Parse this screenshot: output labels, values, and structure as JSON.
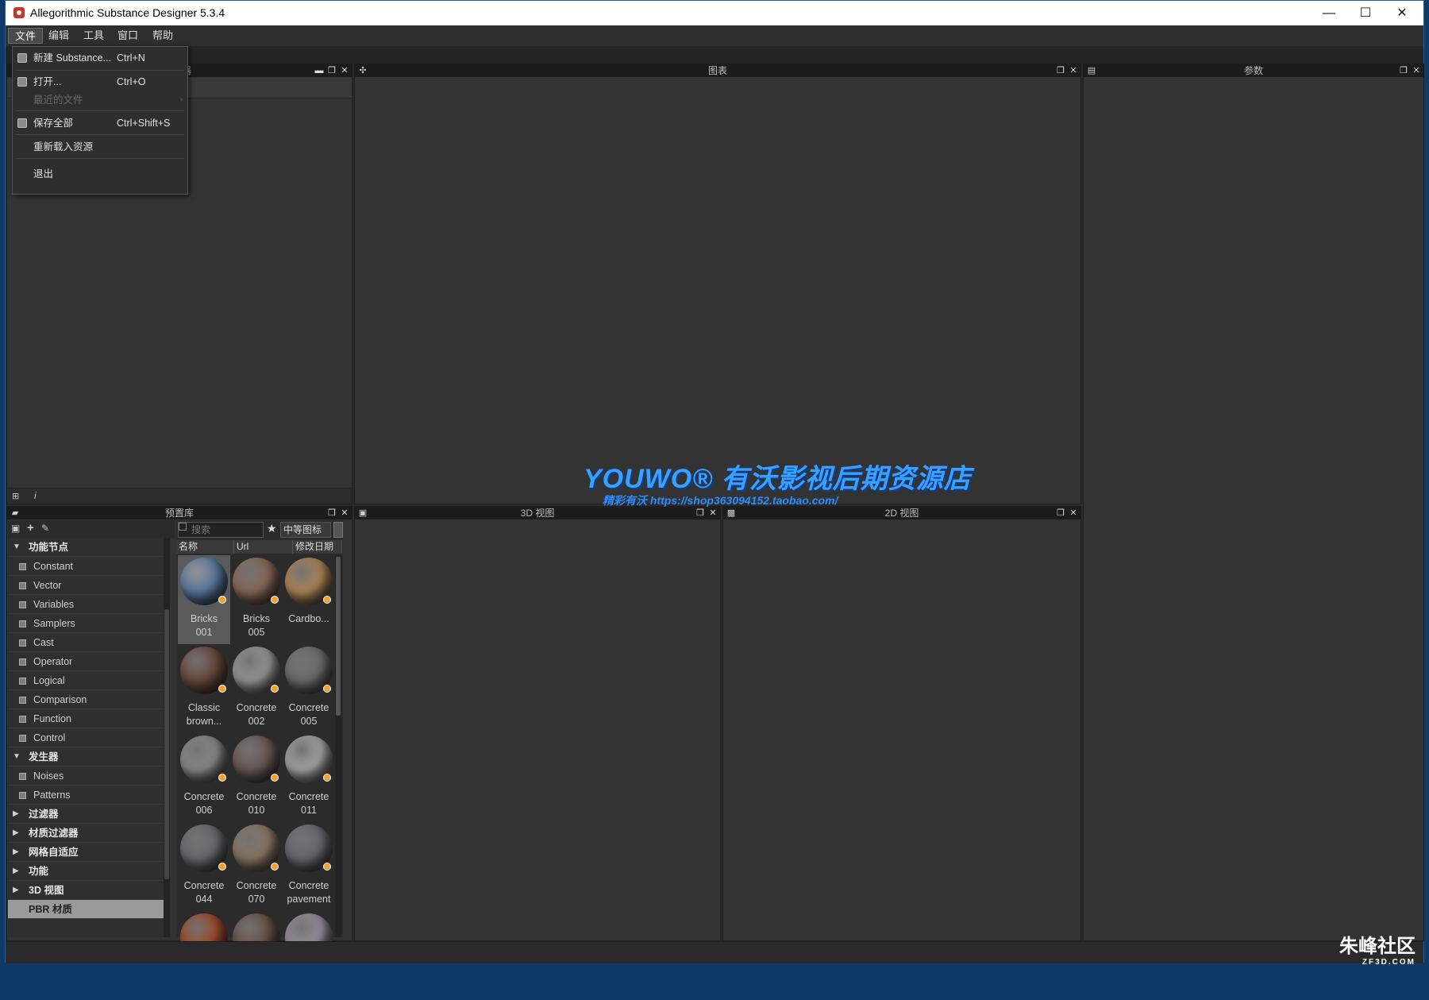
{
  "window": {
    "title": "Allegorithmic Substance Designer 5.3.4",
    "controls": [
      "—",
      "☐",
      "✕"
    ]
  },
  "menubar": {
    "items": [
      "文件",
      "编辑",
      "工具",
      "窗口",
      "帮助"
    ]
  },
  "file_menu": {
    "items": [
      {
        "label": "新建 Substance...",
        "shortcut": "Ctrl+N",
        "icon": "new-icon"
      },
      {
        "label": "打开...",
        "shortcut": "Ctrl+O",
        "icon": "open-icon"
      },
      {
        "label": "最近的文件",
        "shortcut": "",
        "disabled": true,
        "arrow": "›"
      },
      {
        "label": "保存全部",
        "shortcut": "Ctrl+Shift+S",
        "icon": "save-icon"
      },
      {
        "label": "重新载入资源",
        "shortcut": ""
      },
      {
        "label": "退出",
        "shortcut": ""
      }
    ]
  },
  "panels": {
    "explorer": {
      "title": "器",
      "info": "i"
    },
    "graph": {
      "title": "图表"
    },
    "params": {
      "title": "参数"
    },
    "library": {
      "title": "预置库"
    },
    "view3d": {
      "title": "3D 视图"
    },
    "view2d": {
      "title": "2D 视图"
    }
  },
  "library": {
    "tree": [
      {
        "label": "功能节点",
        "type": "cat",
        "expanded": true
      },
      {
        "label": "Constant",
        "type": "item"
      },
      {
        "label": "Vector",
        "type": "item"
      },
      {
        "label": "Variables",
        "type": "item"
      },
      {
        "label": "Samplers",
        "type": "item"
      },
      {
        "label": "Cast",
        "type": "item"
      },
      {
        "label": "Operator",
        "type": "item"
      },
      {
        "label": "Logical",
        "type": "item"
      },
      {
        "label": "Comparison",
        "type": "item"
      },
      {
        "label": "Function",
        "type": "item"
      },
      {
        "label": "Control",
        "type": "item"
      },
      {
        "label": "发生器",
        "type": "cat",
        "expanded": true
      },
      {
        "label": "Noises",
        "type": "item"
      },
      {
        "label": "Patterns",
        "type": "item"
      },
      {
        "label": "过滤器",
        "type": "cat",
        "expanded": false
      },
      {
        "label": "材质过滤器",
        "type": "cat",
        "expanded": false
      },
      {
        "label": "网格自适应",
        "type": "cat",
        "expanded": false
      },
      {
        "label": "功能",
        "type": "cat",
        "expanded": false
      },
      {
        "label": "3D 视图",
        "type": "cat",
        "expanded": false
      },
      {
        "label": "PBR 材质",
        "type": "sel"
      }
    ],
    "search": {
      "placeholder": "搜索"
    },
    "view_mode": "中等图标",
    "columns": [
      "名称",
      "Url",
      "修改日期"
    ],
    "materials": [
      {
        "name": "Bricks\n001",
        "color": "#5a7aa0",
        "selected": true
      },
      {
        "name": "Bricks\n005",
        "color": "#8a6a58"
      },
      {
        "name": "Cardbo...",
        "color": "#b08858"
      },
      {
        "name": "Classic\nbrown...",
        "color": "#6a4a3c"
      },
      {
        "name": "Concrete\n002",
        "color": "#9a9a9a"
      },
      {
        "name": "Concrete\n005",
        "color": "#6e6e6e"
      },
      {
        "name": "Concrete\n006",
        "color": "#8c8c8c"
      },
      {
        "name": "Concrete\n010",
        "color": "#6a5a56"
      },
      {
        "name": "Concrete\n011",
        "color": "#a8a8a8"
      },
      {
        "name": "Concrete\n044",
        "color": "#6a6c6e"
      },
      {
        "name": "Concrete\n070",
        "color": "#8a7864"
      },
      {
        "name": "Concrete\npavement",
        "color": "#6a6a70"
      },
      {
        "name": "",
        "color": "#a04a2a"
      },
      {
        "name": "",
        "color": "#6a5048"
      },
      {
        "name": "",
        "color": "#9a90a0"
      }
    ]
  },
  "watermark": {
    "brand": "YOUWO",
    "shop": "有沃影视后期资源店",
    "sub": "精彩有沃 https://shop363094152.taobao.com/"
  },
  "corner_logo": {
    "name": "朱峰社区",
    "site": "ZF3D.COM"
  }
}
